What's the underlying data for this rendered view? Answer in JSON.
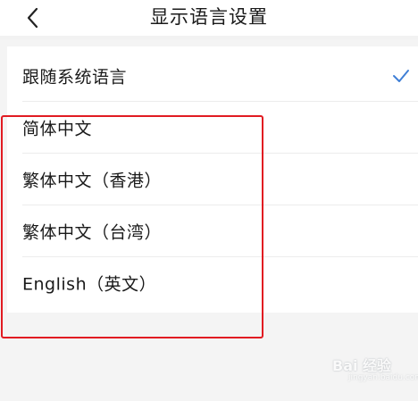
{
  "header": {
    "title": "显示语言设置",
    "back_icon": "chevron-left-icon"
  },
  "languages": [
    {
      "label": "跟随系统语言",
      "selected": true
    },
    {
      "label": "简体中文",
      "selected": false
    },
    {
      "label": "繁体中文（香港）",
      "selected": false
    },
    {
      "label": "繁体中文（台湾）",
      "selected": false
    },
    {
      "label": "English（英文）",
      "selected": false
    }
  ],
  "check_icon": "checkmark-icon",
  "colors": {
    "accent_check": "#3f7fd6",
    "highlight_border": "#e11b22",
    "page_background": "#f4f4f4"
  },
  "watermark": {
    "text": "Bai 经验",
    "subtext": "jingyan.baidu.com"
  }
}
